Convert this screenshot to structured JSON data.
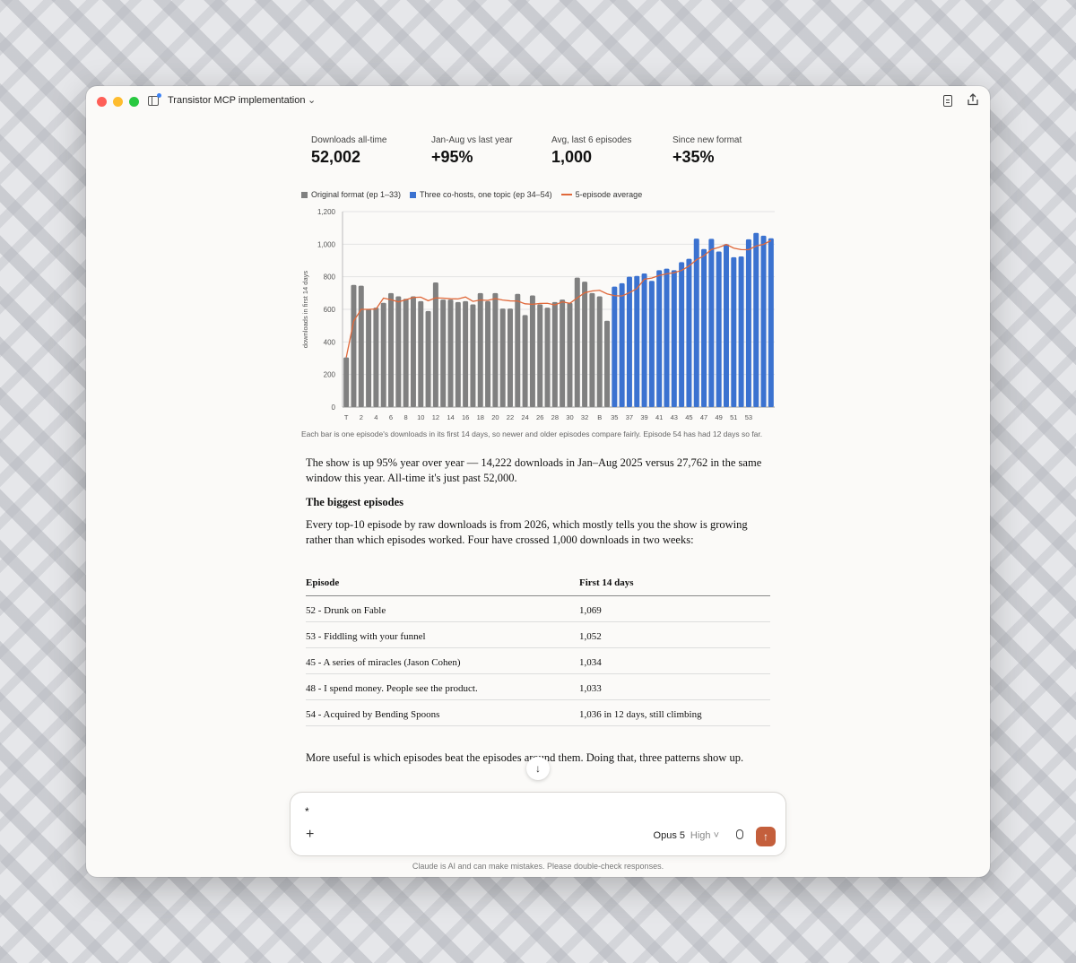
{
  "window": {
    "title": "Transistor MCP implementation"
  },
  "stats": [
    {
      "label": "Downloads all-time",
      "value": "52,002"
    },
    {
      "label": "Jan-Aug vs last year",
      "value": "+95%"
    },
    {
      "label": "Avg, last 6 episodes",
      "value": "1,000"
    },
    {
      "label": "Since new format",
      "value": "+35%"
    }
  ],
  "legend": [
    {
      "label": "Original format (ep 1–33)",
      "color": "#808080"
    },
    {
      "label": "Three co-hosts, one topic (ep 34–54)",
      "color": "#3b72d0"
    },
    {
      "label": "5-episode average",
      "color": "#e0683a"
    }
  ],
  "chart_data": {
    "type": "bar",
    "ylabel": "downloads in first 14 days",
    "ylim": [
      0,
      1200
    ],
    "yticks": [
      "0",
      "200",
      "400",
      "600",
      "800",
      "1,000",
      "1,200"
    ],
    "xtick_labels": [
      "T",
      "2",
      "4",
      "6",
      "8",
      "10",
      "12",
      "14",
      "16",
      "18",
      "20",
      "22",
      "24",
      "26",
      "28",
      "30",
      "32",
      "B",
      "35",
      "37",
      "39",
      "41",
      "43",
      "45",
      "47",
      "49",
      "51",
      "53"
    ],
    "values": [
      305,
      750,
      745,
      600,
      610,
      640,
      700,
      680,
      665,
      680,
      650,
      590,
      765,
      660,
      660,
      645,
      650,
      630,
      700,
      650,
      700,
      605,
      605,
      695,
      565,
      685,
      630,
      610,
      645,
      660,
      640,
      795,
      770,
      700,
      680,
      530,
      740,
      760,
      800,
      805,
      820,
      775,
      840,
      850,
      840,
      890,
      910,
      1034,
      970,
      1033,
      955,
      1000,
      920,
      925,
      1030,
      1069,
      1052,
      1036
    ],
    "series_split_index": 36,
    "series": [
      {
        "name": "Original format (ep 1–33)",
        "color": "#808080"
      },
      {
        "name": "Three co-hosts, one topic (ep 34–54)",
        "color": "#3b72d0"
      },
      {
        "name": "5-episode average",
        "color": "#e0683a"
      }
    ],
    "grid": true,
    "legend_position": "top-left"
  },
  "caption": "Each bar is one episode's downloads in its first 14 days, so newer and older episodes compare fairly. Episode 54 has had 12 days so far.",
  "prose": {
    "p1": "The show is up 95% year over year — 14,222 downloads in Jan–Aug 2025 versus 27,762 in the same window this year. All-time it's just past 52,000.",
    "h3": "The biggest episodes",
    "p2": "Every top-10 episode by raw downloads is from 2026, which mostly tells you the show is growing rather than which episodes worked. Four have crossed 1,000 downloads in two weeks:",
    "p3": "More useful is which episodes beat the episodes around them. Doing that, three patterns show up."
  },
  "table": {
    "headers": [
      "Episode",
      "First 14 days"
    ],
    "rows": [
      [
        "52 - Drunk on Fable",
        "1,069"
      ],
      [
        "53 - Fiddling with your funnel",
        "1,052"
      ],
      [
        "45 - A series of miracles (Jason Cohen)",
        "1,034"
      ],
      [
        "48 - I spend money. People see the product.",
        "1,033"
      ],
      [
        "54 - Acquired by Bending Spoons",
        "1,036 in 12 days, still climbing"
      ]
    ]
  },
  "composer": {
    "input_value": "*",
    "model": "Opus 5",
    "effort": "High",
    "plus": "+",
    "send": "↑",
    "effort_chevron": "˅"
  },
  "scroll_button": "↓",
  "title_chevron": "⌄",
  "disclaimer": "Claude is AI and can make mistakes. Please double-check responses."
}
